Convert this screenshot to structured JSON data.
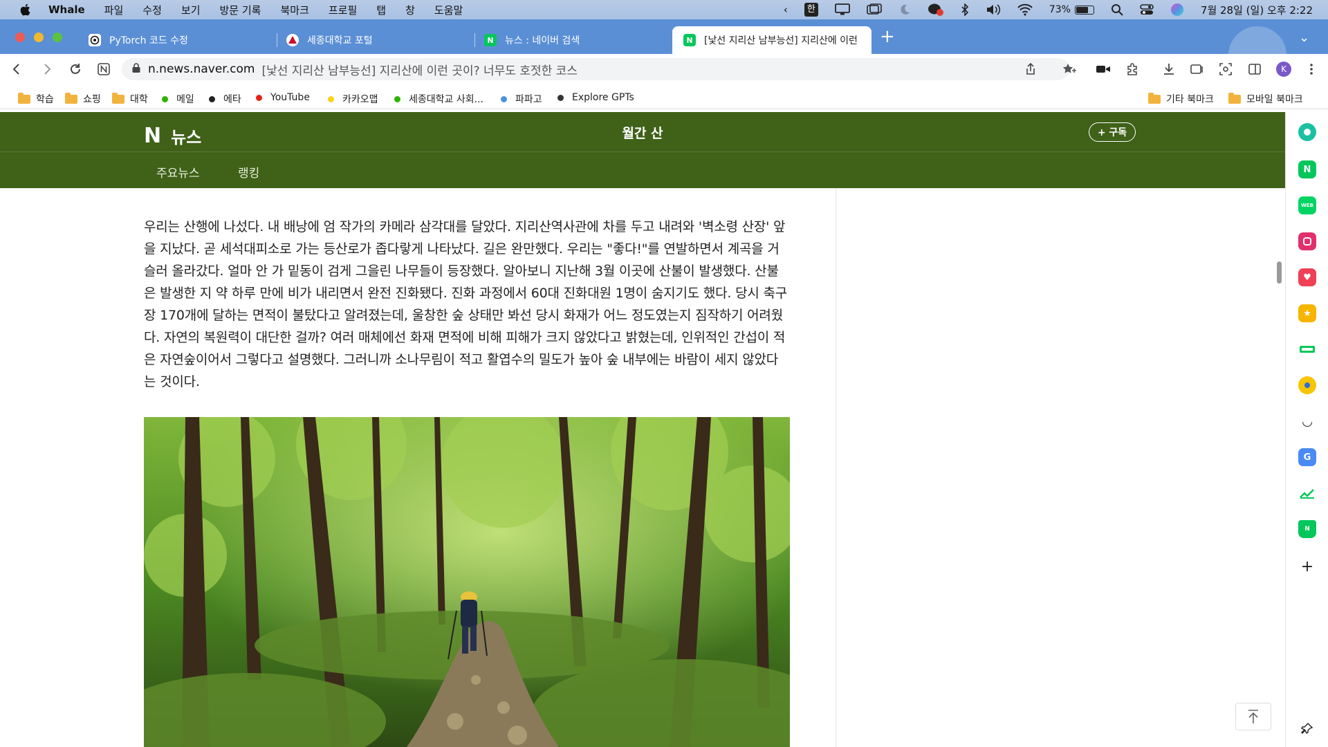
{
  "menubar": {
    "app_name": "Whale",
    "items": [
      "파일",
      "수정",
      "보기",
      "방문 기록",
      "북마크",
      "프로필",
      "탭",
      "창",
      "도움말"
    ],
    "ime": "한",
    "battery_percent": "73%",
    "battery_level": 0.73,
    "datetime": "7월 28일 (일) 오후 2:22"
  },
  "tabs": [
    {
      "title": "PyTorch 코드 수정",
      "icon": "openai-icon",
      "active": false
    },
    {
      "title": "세종대학교 포털",
      "icon": "sejong-icon",
      "active": false
    },
    {
      "title": "뉴스 : 네이버 검색",
      "icon": "naver-icon",
      "active": false
    },
    {
      "title": "[낯선 지리산 남부능선] 지리산에 이런",
      "icon": "naver-icon",
      "active": true
    }
  ],
  "omnibox": {
    "domain": "n.news.naver.com",
    "page_title": "[낯선 지리산 남부능선] 지리산에 이런 곳이? 너무도 호젓한 코스"
  },
  "bookmarks": {
    "left": [
      {
        "label": "학습",
        "type": "folder"
      },
      {
        "label": "쇼핑",
        "type": "folder"
      },
      {
        "label": "대학",
        "type": "folder"
      },
      {
        "label": "메일",
        "type": "dot",
        "color": "#2db400"
      },
      {
        "label": "에타",
        "type": "dot",
        "color": "#222222"
      },
      {
        "label": "YouTube",
        "type": "dot",
        "color": "#e62117"
      },
      {
        "label": "카카오맵",
        "type": "dot",
        "color": "#f7d51d"
      },
      {
        "label": "세종대학교 사회...",
        "type": "dot",
        "color": "#2db400"
      },
      {
        "label": "파파고",
        "type": "dot",
        "color": "#4a90e2"
      },
      {
        "label": "Explore GPTs",
        "type": "dot",
        "color": "#333333"
      }
    ],
    "right": [
      {
        "label": "기타 북마크",
        "type": "folder"
      },
      {
        "label": "모바일 북마크",
        "type": "folder"
      }
    ]
  },
  "news_header": {
    "logo_n": "N",
    "logo_text": "뉴스",
    "press_name": "월간 산",
    "subscribe_label": "+ 구독",
    "tabs": [
      "주요뉴스",
      "랭킹"
    ],
    "bg_color": "#3f6118"
  },
  "article": {
    "body": "우리는 산행에 나섰다. 내 배낭에 엄 작가의 카메라 삼각대를 달았다. 지리산역사관에 차를 두고 내려와 '벽소령 산장' 앞을 지났다. 곧 세석대피소로 가는 등산로가 좁다랗게 나타났다. 길은 완만했다. 우리는 \"좋다!\"를 연발하면서 계곡을 거슬러 올라갔다. 얼마 안 가 밑동이 검게 그을린 나무들이 등장했다. 알아보니 지난해 3월 이곳에 산불이 발생했다. 산불은 발생한 지 약 하루 만에 비가 내리면서 완전 진화됐다. 진화 과정에서 60대 진화대원 1명이 숨지기도 했다. 당시 축구장 170개에 달하는 면적이 불탔다고 알려졌는데, 울창한 숲 상태만 봐선 당시 화재가 어느 정도였는지 짐작하기 어려웠다. 자연의 복원력이 대단한 걸까? 여러 매체에선 화재 면적에 비해 피해가 크지 않았다고 밝혔는데, 인위적인 간섭이 적은 자연숲이어서 그렇다고 설명했다. 그러니까 소나무림이 적고 활엽수의 밀도가 높아 숲 내부에는 바람이 세지 않았다는 것이다."
  },
  "sidebar_apps": [
    {
      "name": "whale-space-icon",
      "color": "#19c1a0"
    },
    {
      "name": "naver-icon",
      "color": "#03c75a"
    },
    {
      "name": "webtoon-icon",
      "color": "#00d564"
    },
    {
      "name": "instagram-icon",
      "color": "#e1306c"
    },
    {
      "name": "pocket-icon",
      "color": "#ef4056"
    },
    {
      "name": "favorites-icon",
      "color": "#f7b500"
    },
    {
      "name": "wallet-icon",
      "color": "#03c75a"
    },
    {
      "name": "map-icon",
      "color": "#f7c600"
    },
    {
      "name": "emoji-icon",
      "color": "#222222"
    },
    {
      "name": "translate-icon",
      "color": "#4a8af4"
    },
    {
      "name": "stock-icon",
      "color": "#03c75a"
    },
    {
      "name": "shopping-icon",
      "color": "#03c75a"
    }
  ]
}
